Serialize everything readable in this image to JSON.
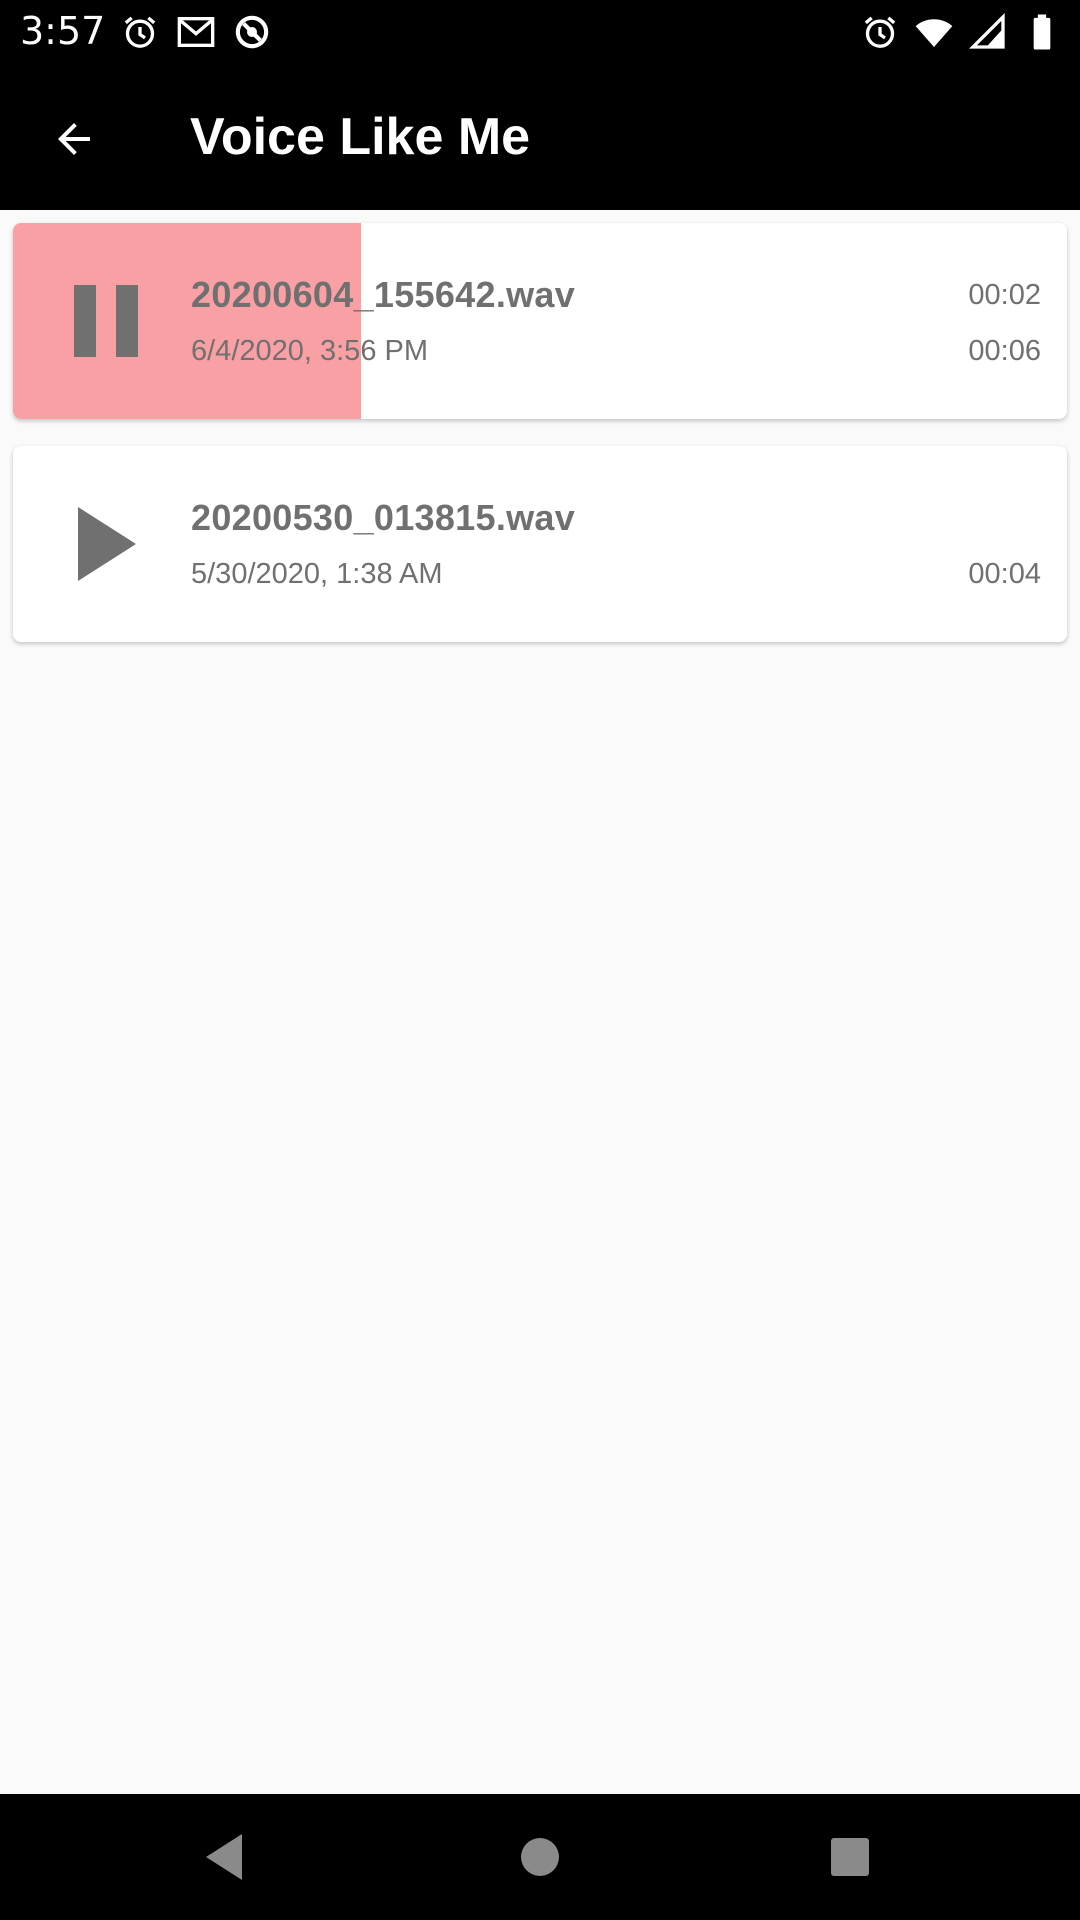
{
  "status_bar": {
    "time": "3:57",
    "left_icons": [
      "alarm-icon",
      "gmail-icon",
      "sync-icon"
    ],
    "right_icons": [
      "alarm-icon",
      "wifi-icon",
      "signal-icon",
      "battery-icon"
    ]
  },
  "app_bar": {
    "back_icon": "arrow-back-icon",
    "title": "Voice Like Me"
  },
  "recordings": [
    {
      "file_name": "20200604_155642.wav",
      "date": "6/4/2020, 3:56 PM",
      "elapsed": "00:02",
      "duration": "00:06",
      "state": "playing",
      "control_icon": "pause-icon",
      "progress_fraction": 0.33
    },
    {
      "file_name": "20200530_013815.wav",
      "date": "5/30/2020, 1:38 AM",
      "elapsed": "",
      "duration": "00:04",
      "state": "stopped",
      "control_icon": "play-icon",
      "progress_fraction": 0
    }
  ],
  "colors": {
    "progress": "#f9a0a5",
    "text_secondary": "#707070",
    "app_bar": "#000000",
    "background": "#fafafa"
  },
  "nav_bar": {
    "buttons": [
      "back-triangle-icon",
      "home-circle-icon",
      "recents-square-icon"
    ]
  }
}
